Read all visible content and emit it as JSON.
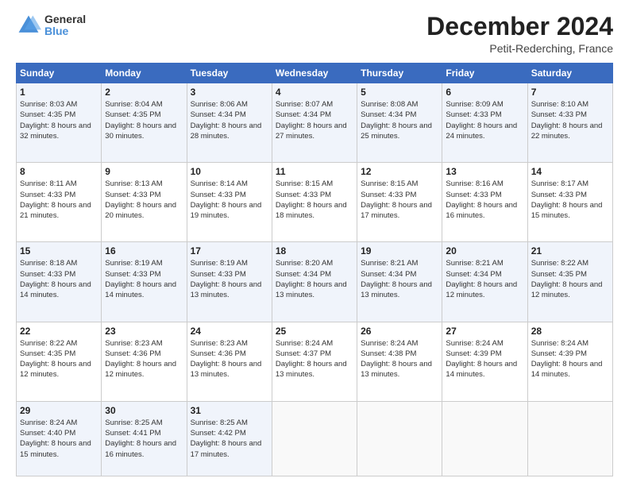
{
  "header": {
    "logo_line1": "General",
    "logo_line2": "Blue",
    "month_title": "December 2024",
    "location": "Petit-Rederching, France"
  },
  "days_of_week": [
    "Sunday",
    "Monday",
    "Tuesday",
    "Wednesday",
    "Thursday",
    "Friday",
    "Saturday"
  ],
  "weeks": [
    [
      {
        "day": 1,
        "sunrise": "8:03 AM",
        "sunset": "4:35 PM",
        "daylight": "8 hours and 32 minutes"
      },
      {
        "day": 2,
        "sunrise": "8:04 AM",
        "sunset": "4:35 PM",
        "daylight": "8 hours and 30 minutes"
      },
      {
        "day": 3,
        "sunrise": "8:06 AM",
        "sunset": "4:34 PM",
        "daylight": "8 hours and 28 minutes"
      },
      {
        "day": 4,
        "sunrise": "8:07 AM",
        "sunset": "4:34 PM",
        "daylight": "8 hours and 27 minutes"
      },
      {
        "day": 5,
        "sunrise": "8:08 AM",
        "sunset": "4:34 PM",
        "daylight": "8 hours and 25 minutes"
      },
      {
        "day": 6,
        "sunrise": "8:09 AM",
        "sunset": "4:33 PM",
        "daylight": "8 hours and 24 minutes"
      },
      {
        "day": 7,
        "sunrise": "8:10 AM",
        "sunset": "4:33 PM",
        "daylight": "8 hours and 22 minutes"
      }
    ],
    [
      {
        "day": 8,
        "sunrise": "8:11 AM",
        "sunset": "4:33 PM",
        "daylight": "8 hours and 21 minutes"
      },
      {
        "day": 9,
        "sunrise": "8:13 AM",
        "sunset": "4:33 PM",
        "daylight": "8 hours and 20 minutes"
      },
      {
        "day": 10,
        "sunrise": "8:14 AM",
        "sunset": "4:33 PM",
        "daylight": "8 hours and 19 minutes"
      },
      {
        "day": 11,
        "sunrise": "8:15 AM",
        "sunset": "4:33 PM",
        "daylight": "8 hours and 18 minutes"
      },
      {
        "day": 12,
        "sunrise": "8:15 AM",
        "sunset": "4:33 PM",
        "daylight": "8 hours and 17 minutes"
      },
      {
        "day": 13,
        "sunrise": "8:16 AM",
        "sunset": "4:33 PM",
        "daylight": "8 hours and 16 minutes"
      },
      {
        "day": 14,
        "sunrise": "8:17 AM",
        "sunset": "4:33 PM",
        "daylight": "8 hours and 15 minutes"
      }
    ],
    [
      {
        "day": 15,
        "sunrise": "8:18 AM",
        "sunset": "4:33 PM",
        "daylight": "8 hours and 14 minutes"
      },
      {
        "day": 16,
        "sunrise": "8:19 AM",
        "sunset": "4:33 PM",
        "daylight": "8 hours and 14 minutes"
      },
      {
        "day": 17,
        "sunrise": "8:19 AM",
        "sunset": "4:33 PM",
        "daylight": "8 hours and 13 minutes"
      },
      {
        "day": 18,
        "sunrise": "8:20 AM",
        "sunset": "4:34 PM",
        "daylight": "8 hours and 13 minutes"
      },
      {
        "day": 19,
        "sunrise": "8:21 AM",
        "sunset": "4:34 PM",
        "daylight": "8 hours and 13 minutes"
      },
      {
        "day": 20,
        "sunrise": "8:21 AM",
        "sunset": "4:34 PM",
        "daylight": "8 hours and 12 minutes"
      },
      {
        "day": 21,
        "sunrise": "8:22 AM",
        "sunset": "4:35 PM",
        "daylight": "8 hours and 12 minutes"
      }
    ],
    [
      {
        "day": 22,
        "sunrise": "8:22 AM",
        "sunset": "4:35 PM",
        "daylight": "8 hours and 12 minutes"
      },
      {
        "day": 23,
        "sunrise": "8:23 AM",
        "sunset": "4:36 PM",
        "daylight": "8 hours and 12 minutes"
      },
      {
        "day": 24,
        "sunrise": "8:23 AM",
        "sunset": "4:36 PM",
        "daylight": "8 hours and 13 minutes"
      },
      {
        "day": 25,
        "sunrise": "8:24 AM",
        "sunset": "4:37 PM",
        "daylight": "8 hours and 13 minutes"
      },
      {
        "day": 26,
        "sunrise": "8:24 AM",
        "sunset": "4:38 PM",
        "daylight": "8 hours and 13 minutes"
      },
      {
        "day": 27,
        "sunrise": "8:24 AM",
        "sunset": "4:39 PM",
        "daylight": "8 hours and 14 minutes"
      },
      {
        "day": 28,
        "sunrise": "8:24 AM",
        "sunset": "4:39 PM",
        "daylight": "8 hours and 14 minutes"
      }
    ],
    [
      {
        "day": 29,
        "sunrise": "8:24 AM",
        "sunset": "4:40 PM",
        "daylight": "8 hours and 15 minutes"
      },
      {
        "day": 30,
        "sunrise": "8:25 AM",
        "sunset": "4:41 PM",
        "daylight": "8 hours and 16 minutes"
      },
      {
        "day": 31,
        "sunrise": "8:25 AM",
        "sunset": "4:42 PM",
        "daylight": "8 hours and 17 minutes"
      },
      null,
      null,
      null,
      null
    ]
  ]
}
